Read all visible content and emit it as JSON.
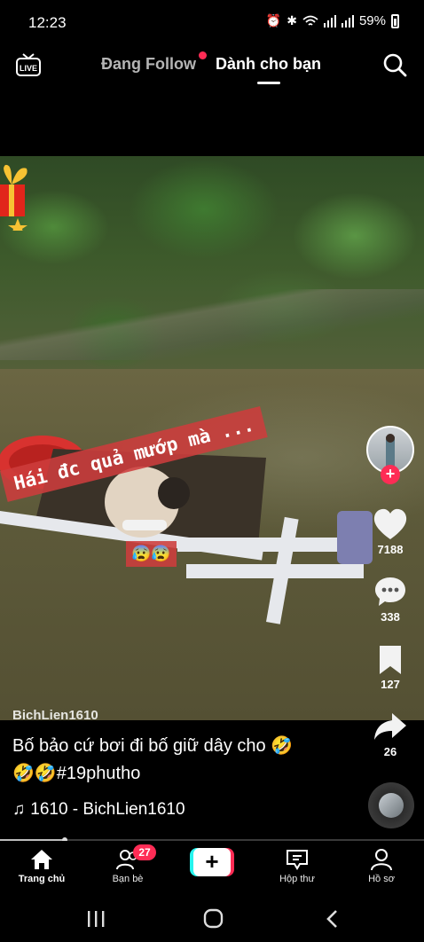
{
  "status_bar": {
    "time": "12:23",
    "battery_percent": "59%"
  },
  "top_nav": {
    "tabs": [
      {
        "label": "Đang Follow",
        "active": false,
        "has_dot": true
      },
      {
        "label": "Dành cho bạn",
        "active": true
      }
    ],
    "live_label": "LIVE"
  },
  "video": {
    "overlay_text": "Hái đc quả mướp mà ...",
    "overlay_emoji": "😰😰",
    "watermark": "BichLien1610",
    "close_glyph": "×"
  },
  "rail": {
    "likes": "7188",
    "comments": "338",
    "bookmarks": "127",
    "shares": "26"
  },
  "post": {
    "description_line1": "Bố bảo cứ bơi đi bố giữ dây cho 🤣",
    "description_line2": "🤣🤣#19phutho",
    "music_note": "♫",
    "music": "1610 - BichLien1610"
  },
  "playback": {
    "progress": 0.15
  },
  "bottom_nav": {
    "items": [
      {
        "label": "Trang chủ",
        "active": true
      },
      {
        "label": "Bạn bè",
        "badge": "27"
      },
      {
        "label": "+"
      },
      {
        "label": "Hộp thư"
      },
      {
        "label": "Hồ sơ"
      }
    ]
  },
  "colors": {
    "accent": "#fe2c55",
    "cyan": "#25f4ee"
  }
}
